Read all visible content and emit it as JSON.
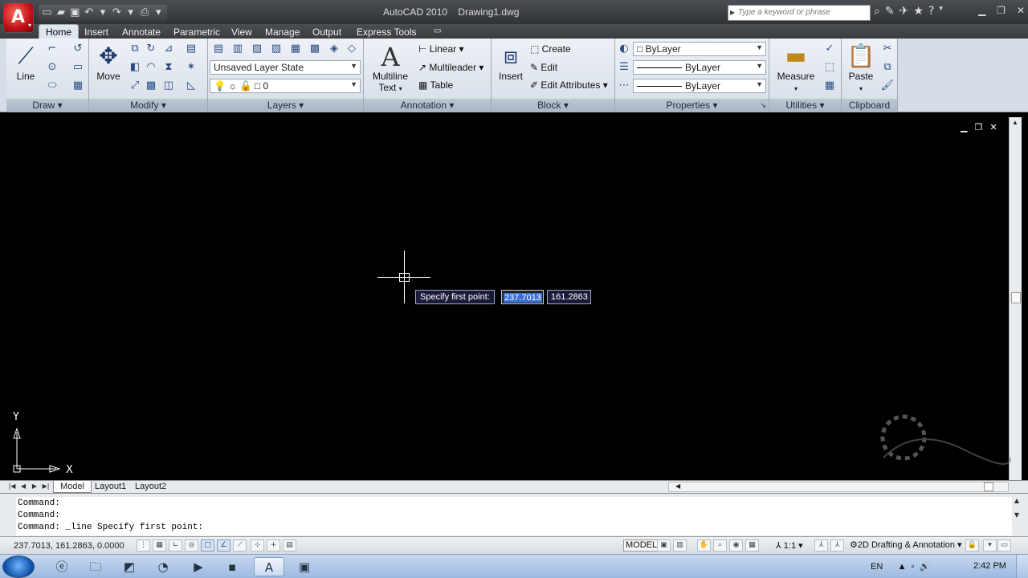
{
  "window": {
    "app_title": "AutoCAD 2010",
    "file_name": "Drawing1.dwg",
    "search_placeholder": "Type a keyword or phrase"
  },
  "tabs": [
    "Home",
    "Insert",
    "Annotate",
    "Parametric",
    "View",
    "Manage",
    "Output",
    "Express Tools"
  ],
  "ribbon": {
    "draw": {
      "title": "Draw",
      "line_label": "Line"
    },
    "modify": {
      "title": "Modify",
      "move_label": "Move"
    },
    "layers": {
      "title": "Layers",
      "layer_state": "Unsaved Layer State",
      "current_layer": "0"
    },
    "annotation": {
      "title": "Annotation",
      "multiline_text": "Multiline",
      "multiline_text2": "Text",
      "linear": "Linear",
      "multileader": "Multileader",
      "table": "Table"
    },
    "block": {
      "title": "Block",
      "insert": "Insert",
      "create": "Create",
      "edit": "Edit",
      "edit_attributes": "Edit Attributes"
    },
    "properties": {
      "title": "Properties",
      "color": "ByLayer",
      "linetype": "ByLayer",
      "lineweight": "ByLayer"
    },
    "utilities": {
      "title": "Utilities",
      "measure": "Measure"
    },
    "clipboard": {
      "title": "Clipboard",
      "paste": "Paste"
    }
  },
  "drawing": {
    "tooltip": "Specify first point:",
    "input_x": "237.7013",
    "input_y": "161.2863",
    "ucs_x": "X",
    "ucs_y": "Y"
  },
  "layout_tabs": [
    "Model",
    "Layout1",
    "Layout2"
  ],
  "command_history": [
    "Command:",
    "Command:",
    "Command: _line Specify first point:"
  ],
  "status": {
    "coords": "237.7013, 161.2863, 0.0000",
    "model": "MODEL",
    "anno_scale": "1:1",
    "workspace": "2D Drafting & Annotation"
  },
  "taskbar": {
    "lang": "EN",
    "clock": "2:42 PM"
  }
}
